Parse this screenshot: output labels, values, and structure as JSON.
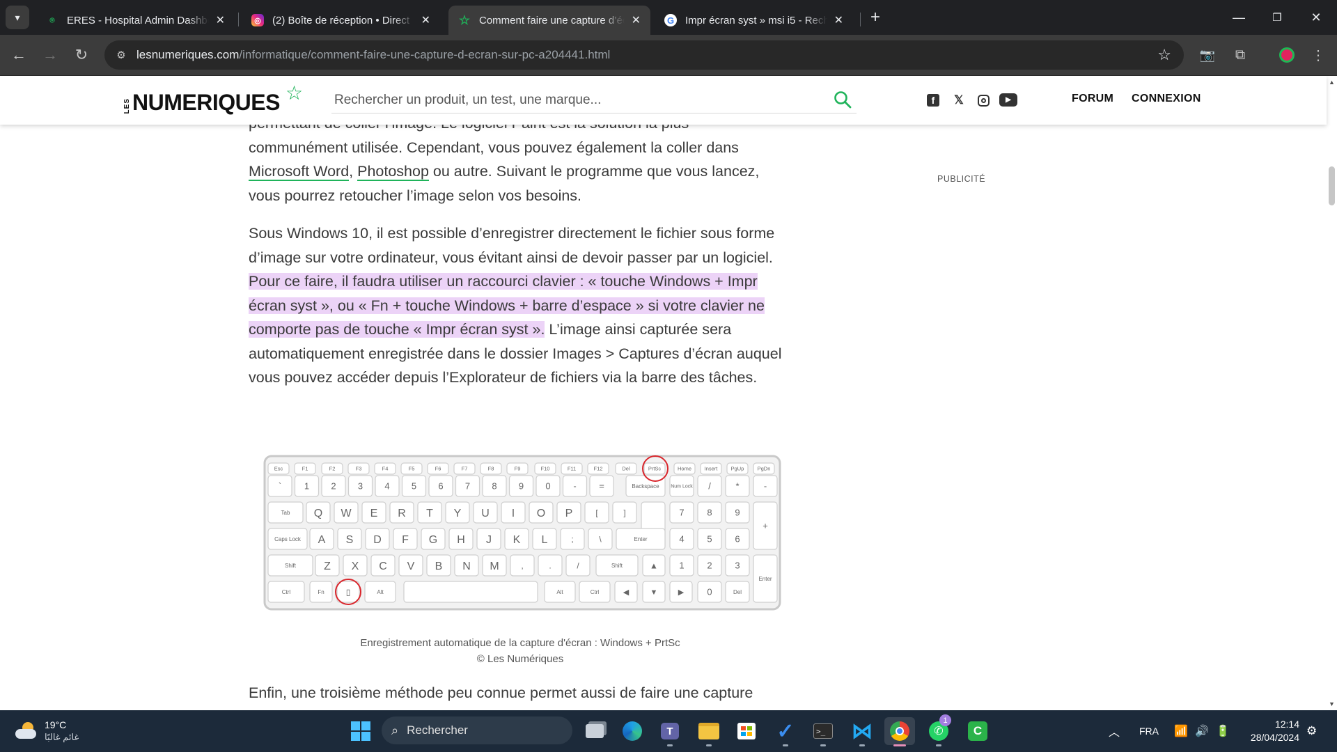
{
  "browser": {
    "tabs": [
      {
        "title": "ERES - Hospital Admin Dashboard",
        "favicon": "location-pin-icon"
      },
      {
        "title": "(2) Boîte de réception • Direct",
        "favicon": "instagram-icon"
      },
      {
        "title": "Comment faire une capture d’écran",
        "favicon": "star-icon",
        "active": true
      },
      {
        "title": "Impr écran syst » msi i5 - Recherche",
        "favicon": "google-icon"
      }
    ],
    "url_host": "lesnumeriques.com",
    "url_path": "/informatique/comment-faire-une-capture-d-ecran-sur-pc-a204441.html"
  },
  "site": {
    "logo_les": "LES",
    "logo_name": "NUMERIQUES",
    "search_placeholder": "Rechercher un produit, un test, une marque...",
    "nav": {
      "forum": "FORUM",
      "login": "CONNEXION"
    },
    "ad_label": "PUBLICITÉ",
    "accent_color": "#1fb35a"
  },
  "article": {
    "p1_cut": "permettant de coller l’image. Le logiciel Paint est la solution la plus",
    "p1_a": "communément utilisée. Cependant, vous pouvez également la coller dans",
    "p1_link1": "Microsoft Word",
    "p1_sep": ", ",
    "p1_link2": "Photoshop",
    "p1_b": " ou autre. Suivant le programme que vous lancez,",
    "p1_c": "vous pourrez retoucher l’image selon vos besoins.",
    "p2_a": "Sous Windows 10, il est possible d’enregistrer directement le fichier sous forme d’image sur votre ordinateur, vous évitant ainsi de devoir passer par un logiciel. ",
    "p2_highlight": "Pour ce faire, il faudra utiliser un raccourci clavier : « touche Windows + Impr écran syst », ou « Fn + touche Windows + barre d’espace » si votre clavier ne comporte pas de touche « Impr écran syst ».",
    "p2_b": " L’image ainsi capturée sera automatiquement enregistrée dans le dossier Images > Captures d’écran auquel vous pouvez accéder depuis l’Explorateur de fichiers via la barre des tâches.",
    "caption": "Enregistrement automatique de la capture d'écran : Windows + PrtSc",
    "credit": "© Les Numériques",
    "p3": "Enfin, une troisième méthode peu connue permet aussi de faire une capture"
  },
  "keyboard": {
    "fn_row": [
      "Esc",
      "F1",
      "F2",
      "F3",
      "F4",
      "F5",
      "F6",
      "F7",
      "F8",
      "F9",
      "F10",
      "F11",
      "F12",
      "Del",
      "PrtSc",
      "Home",
      "Insert",
      "PgUp",
      "PgDn"
    ],
    "num_row": [
      "`",
      "1",
      "2",
      "3",
      "4",
      "5",
      "6",
      "7",
      "8",
      "9",
      "0",
      "-",
      "=",
      "Backspace",
      "Num Lock",
      "/",
      "*",
      "-"
    ],
    "row_q": [
      "Tab",
      "Q",
      "W",
      "E",
      "R",
      "T",
      "Y",
      "U",
      "I",
      "O",
      "P",
      "[",
      "]",
      "7",
      "8",
      "9"
    ],
    "row_a": [
      "Caps Lock",
      "A",
      "S",
      "D",
      "F",
      "G",
      "H",
      "J",
      "K",
      "L",
      ";",
      "\\",
      "Enter",
      "4",
      "5",
      "6"
    ],
    "row_z": [
      "Shift",
      "Z",
      "X",
      "C",
      "V",
      "B",
      "N",
      "M",
      ",",
      ".",
      "/",
      "Shift",
      "▲",
      "1",
      "2",
      "3"
    ],
    "row_ctrl": [
      "Ctrl",
      "Fn",
      "",
      "Alt",
      "",
      "Alt",
      "Ctrl",
      "◀",
      "▼",
      "▶",
      "0",
      "Del"
    ],
    "num_plus": "",
    "num_enter": "Enter",
    "highlight_color": "#d9262c"
  },
  "taskbar": {
    "weather_temp": "19°C",
    "weather_desc": "غائم غالبًا",
    "search_label": "Rechercher",
    "lang": "FRA",
    "time": "12:14",
    "date": "28/04/2024",
    "whatsapp_badge": "1"
  }
}
